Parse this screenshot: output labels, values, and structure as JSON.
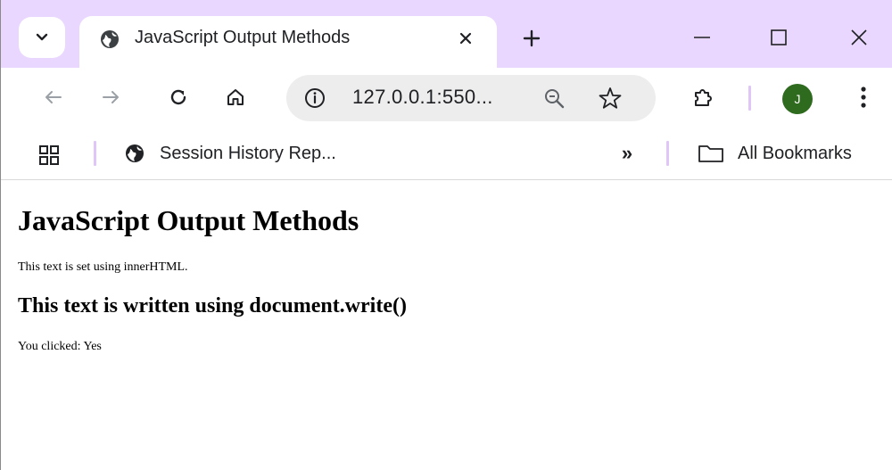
{
  "tab": {
    "title": "JavaScript Output Methods",
    "favicon": "globe-icon"
  },
  "window_controls": [
    "minimize-icon",
    "maximize-icon",
    "close-icon"
  ],
  "toolbar": {
    "url": "127.0.0.1:550...",
    "icons": [
      "back-arrow-icon",
      "forward-arrow-icon",
      "reload-icon",
      "home-icon",
      "site-info-icon",
      "zoom-icon",
      "bookmark-star-icon",
      "extensions-icon",
      "more-menu-icon"
    ],
    "avatar_initial": "J",
    "avatar_color": "#2e6b1e"
  },
  "bookmarks": {
    "item_label": "Session History Rep...",
    "more_label": "»",
    "all_label": "All Bookmarks"
  },
  "page": {
    "heading": "JavaScript Output Methods",
    "inner_html_text": "This text is set using innerHTML.",
    "document_write_text": "This text is written using document.write()",
    "click_result": "You clicked: Yes"
  },
  "colors": {
    "tabstrip_bg": "#e9d7ff",
    "omnibox_bg": "#ededed",
    "separator": "#e0c6f7"
  }
}
